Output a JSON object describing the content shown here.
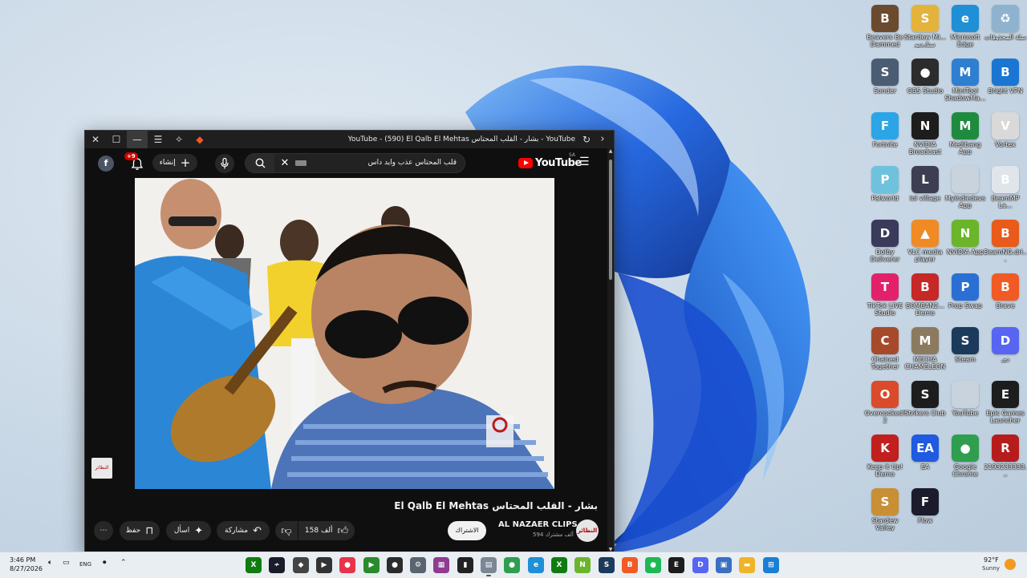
{
  "desktop": {
    "icons": [
      {
        "label": "Beavers Be Dammed",
        "glyph": "B",
        "color": "#6b4a2e"
      },
      {
        "label": "Stardew Mi... ستارديو",
        "glyph": "S",
        "color": "#e4b33c"
      },
      {
        "label": "Microsoft Edge",
        "glyph": "e",
        "color": "#1f8fd6"
      },
      {
        "label": "سلة المحذوفات",
        "glyph": "♻",
        "color": "#8fb3cf"
      },
      {
        "label": "Sonder",
        "glyph": "S",
        "color": "#4b5d73"
      },
      {
        "label": "OBS Studio",
        "glyph": "●",
        "color": "#2c2c2c"
      },
      {
        "label": "MiniTool ShadowMa...",
        "glyph": "M",
        "color": "#2f7fd1"
      },
      {
        "label": "Bright VPN",
        "glyph": "B",
        "color": "#1a76d2"
      },
      {
        "label": "Fortnite",
        "glyph": "F",
        "color": "#2ba5e8"
      },
      {
        "label": "NVIDIA Broadcast",
        "glyph": "N",
        "color": "#1d1d1d"
      },
      {
        "label": "Medibang App",
        "glyph": "M",
        "color": "#1f8b3f"
      },
      {
        "label": "Vortex",
        "glyph": "V",
        "color": "#d9d9d9"
      },
      {
        "label": "Palworld",
        "glyph": "P",
        "color": "#6fc2dd"
      },
      {
        "label": "lol village",
        "glyph": "L",
        "color": "#3e3e52"
      },
      {
        "label": "Myindiedevs App",
        "glyph": "",
        "color": "#c9d3dd"
      },
      {
        "label": "BeamMP La...",
        "glyph": "B",
        "color": "#dfe5eb"
      },
      {
        "label": "Dolby Deliverer",
        "glyph": "D",
        "color": "#3a3a5a"
      },
      {
        "label": "VLC media player",
        "glyph": "▲",
        "color": "#f08a24"
      },
      {
        "label": "NVIDIA App",
        "glyph": "N",
        "color": "#6bb52a"
      },
      {
        "label": "BeamNG.dri...",
        "glyph": "B",
        "color": "#e85b1a"
      },
      {
        "label": "TikTok LIVE Studio",
        "glyph": "T",
        "color": "#e3216a"
      },
      {
        "label": "BOMBAN2... Demo",
        "glyph": "B",
        "color": "#c62828"
      },
      {
        "label": "Prop Swap",
        "glyph": "P",
        "color": "#2a6fd4"
      },
      {
        "label": "Brave",
        "glyph": "B",
        "color": "#f15a24"
      },
      {
        "label": "Chained Together",
        "glyph": "C",
        "color": "#a74a2b"
      },
      {
        "label": "MECHA CHAMELEON",
        "glyph": "M",
        "color": "#8c7a5e"
      },
      {
        "label": "Steam",
        "glyph": "S",
        "color": "#1b3a5c"
      },
      {
        "label": "دي",
        "glyph": "D",
        "color": "#5865f2"
      },
      {
        "label": "Overcooked! 2",
        "glyph": "O",
        "color": "#d94b2b"
      },
      {
        "label": "Strikers Club",
        "glyph": "S",
        "color": "#1d1d1d"
      },
      {
        "label": "YouTube",
        "glyph": "",
        "color": "#c9d3dd"
      },
      {
        "label": "Epic Games Launcher",
        "glyph": "E",
        "color": "#1d1d1d"
      },
      {
        "label": "Keep It Up! Demo",
        "glyph": "K",
        "color": "#c21f1f"
      },
      {
        "label": "EA",
        "glyph": "EA",
        "color": "#1f5ae0"
      },
      {
        "label": "Google Chrome",
        "glyph": "●",
        "color": "#2f9e4f"
      },
      {
        "label": "2193233333...",
        "glyph": "R",
        "color": "#b71c1c"
      },
      {
        "label": "Stardew Valley",
        "glyph": "S",
        "color": "#c98f35"
      },
      {
        "label": "Flow",
        "glyph": "F",
        "color": "#1b1b2b"
      }
    ]
  },
  "browser": {
    "title": "YouTube - (590) El Qalb El Mehtas بشار - القلب المحتاس - YouTube",
    "icons": {
      "close": "close-icon",
      "maximize": "maximize-icon",
      "minimize": "minimize-icon",
      "menu": "menu-icon",
      "extensions": "puzzle-icon",
      "brave": "brave-lion-icon",
      "reload": "reload-icon",
      "back": "chevron-right-icon"
    }
  },
  "youtube": {
    "avatar_letter": "f",
    "notifications_badge": "+9",
    "create_label": "إنشاء",
    "search_query": "قلب المحتاس عذب وايد داس",
    "logo_text": "YouTube",
    "region": "SA",
    "video_title": "بشار - القلب المحتاس El Qalb El Mehtas",
    "channel_name": "AL NAZAER CLIPS",
    "channel_subs": "594 ألف مشترك",
    "channel_logo_text": "النظائر",
    "subscribe_label": "الاشتراك",
    "like_count": "158 ألف",
    "share_label": "مشاركة",
    "remix_label": "اسأل",
    "save_label": "حفظ",
    "more_label": "⋯"
  },
  "taskbar": {
    "time": "3:46 PM",
    "date": "8/27/2026",
    "language": "ENG",
    "weather_temp": "92°F",
    "weather_cond": "Sunny",
    "apps": [
      {
        "name": "xbox",
        "glyph": "X",
        "color": "#107c10"
      },
      {
        "name": "flow",
        "glyph": "≁",
        "color": "#1b1b2b"
      },
      {
        "name": "unity",
        "glyph": "◆",
        "color": "#444"
      },
      {
        "name": "media-player",
        "glyph": "▶",
        "color": "#333"
      },
      {
        "name": "color-app",
        "glyph": "●",
        "color": "#e8334a"
      },
      {
        "name": "nvidia-broadcast",
        "glyph": "▶",
        "color": "#2b8a2b"
      },
      {
        "name": "obs",
        "glyph": "●",
        "color": "#2c2c2c"
      },
      {
        "name": "settings",
        "glyph": "⚙",
        "color": "#5a6470"
      },
      {
        "name": "winrar",
        "glyph": "▦",
        "color": "#8e3b91"
      },
      {
        "name": "phone",
        "glyph": "▮",
        "color": "#222"
      },
      {
        "name": "notepad",
        "glyph": "▤",
        "color": "#7a8794"
      },
      {
        "name": "chrome",
        "glyph": "●",
        "color": "#2f9e4f"
      },
      {
        "name": "edge",
        "glyph": "e",
        "color": "#1f8fd6"
      },
      {
        "name": "xbox-app",
        "glyph": "X",
        "color": "#107c10"
      },
      {
        "name": "nvidia",
        "glyph": "N",
        "color": "#6bb52a"
      },
      {
        "name": "steam",
        "glyph": "S",
        "color": "#1b3a5c"
      },
      {
        "name": "brave",
        "glyph": "B",
        "color": "#f15a24"
      },
      {
        "name": "spotify",
        "glyph": "●",
        "color": "#1db954"
      },
      {
        "name": "epic",
        "glyph": "E",
        "color": "#1d1d1d"
      },
      {
        "name": "discord",
        "glyph": "D",
        "color": "#5865f2"
      },
      {
        "name": "store",
        "glyph": "▣",
        "color": "#3a6fc2"
      },
      {
        "name": "explorer",
        "glyph": "▬",
        "color": "#f0b429"
      },
      {
        "name": "windows",
        "glyph": "⊞",
        "color": "#1a7fd6"
      }
    ]
  }
}
